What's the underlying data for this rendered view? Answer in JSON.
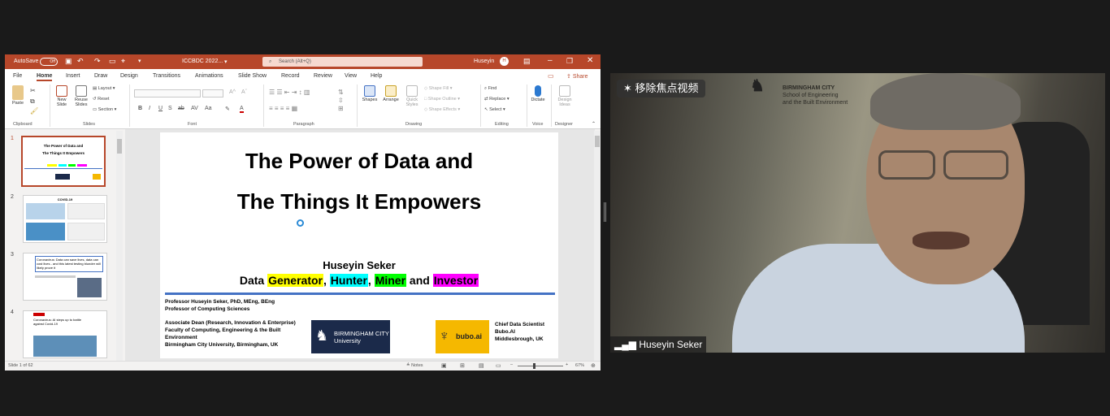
{
  "powerpoint": {
    "titlebar": {
      "autosave_label": "AutoSave",
      "autosave_state": "Off",
      "document_name": "ICCBDC 2022...",
      "search_placeholder": "Search (Alt+Q)",
      "user_name": "Huseyin",
      "user_initial": "H"
    },
    "menu": {
      "tabs": [
        "File",
        "Home",
        "Insert",
        "Draw",
        "Design",
        "Transitions",
        "Animations",
        "Slide Show",
        "Record",
        "Review",
        "View",
        "Help"
      ],
      "active": "Home",
      "comments_icon": "comment-icon",
      "share_label": "Share"
    },
    "ribbon": {
      "clipboard": {
        "paste": "Paste",
        "group": "Clipboard"
      },
      "slides": {
        "new_slide": "New\nSlide",
        "reuse_slides": "Reuse\nSlides",
        "layout": "Layout",
        "reset": "Reset",
        "section": "Section",
        "group": "Slides"
      },
      "font": {
        "group": "Font"
      },
      "paragraph": {
        "group": "Paragraph"
      },
      "drawing": {
        "shapes": "Shapes",
        "arrange": "Arrange",
        "quick_styles": "Quick\nStyles",
        "shape_fill": "Shape Fill",
        "shape_outline": "Shape Outline",
        "shape_effects": "Shape Effects",
        "group": "Drawing"
      },
      "editing": {
        "find": "Find",
        "replace": "Replace",
        "select": "Select",
        "group": "Editing"
      },
      "voice": {
        "dictate": "Dictate",
        "group": "Voice"
      },
      "designer": {
        "design_ideas": "Design\nIdeas",
        "group": "Designer"
      }
    },
    "thumbnails": [
      {
        "number": "1",
        "title": "The Power of Data  and",
        "subtitle": "The Things It Empowers"
      },
      {
        "number": "2",
        "title": "COVID-19"
      },
      {
        "number": "3",
        "title": "Coronavirus: Data can save lives, data can cost lives - and this latest testing blunder will likely prove it"
      },
      {
        "number": "4",
        "title": "Coronavirus: AI steps up to battle against Covid-19"
      }
    ],
    "slide": {
      "title_line1": "The Power of Data  and",
      "title_line2": "The Things It Empowers",
      "presenter": "Huseyin Seker",
      "roles": {
        "prefix": "Data",
        "r1": "Generator",
        "r2": "Hunter",
        "r3": "Miner",
        "and": "and",
        "r4": "Investor"
      },
      "role_colors": {
        "r1": "#ffff00",
        "r2": "#00ffff",
        "r3": "#00ff00",
        "r4": "#ff00ff"
      },
      "rule_color": "#4472c4",
      "left_block": {
        "line1": "Professor Huseyin Seker, PhD, MEng, BEng",
        "line2": "Professor of Computing Sciences",
        "line3": "Associate Dean (Research, Innovation & Enterprise)",
        "line4": "Faculty of Computing, Engineering & the Built",
        "line5": "Environment",
        "line6": "Birmingham City University, Birmingham, UK"
      },
      "bcu_logo": {
        "line1": "BIRMINGHAM CITY",
        "line2": "University"
      },
      "bubo_logo": {
        "text": "bubo.ai"
      },
      "right_block": {
        "line1": "Chief Data Scientist",
        "line2": "Bubo.AI",
        "line3": "Middlesbrough, UK"
      }
    },
    "status": {
      "slide_counter": "Slide 1 of 62",
      "notes": "Notes",
      "zoom": "67%"
    }
  },
  "video": {
    "pin_label": "移除焦点视频",
    "participant_name": "Huseyin Seker",
    "backdrop_text": {
      "line1": "BIRMINGHAM CITY",
      "line2": "School of Engineering",
      "line3": "and the Built Environment"
    }
  }
}
